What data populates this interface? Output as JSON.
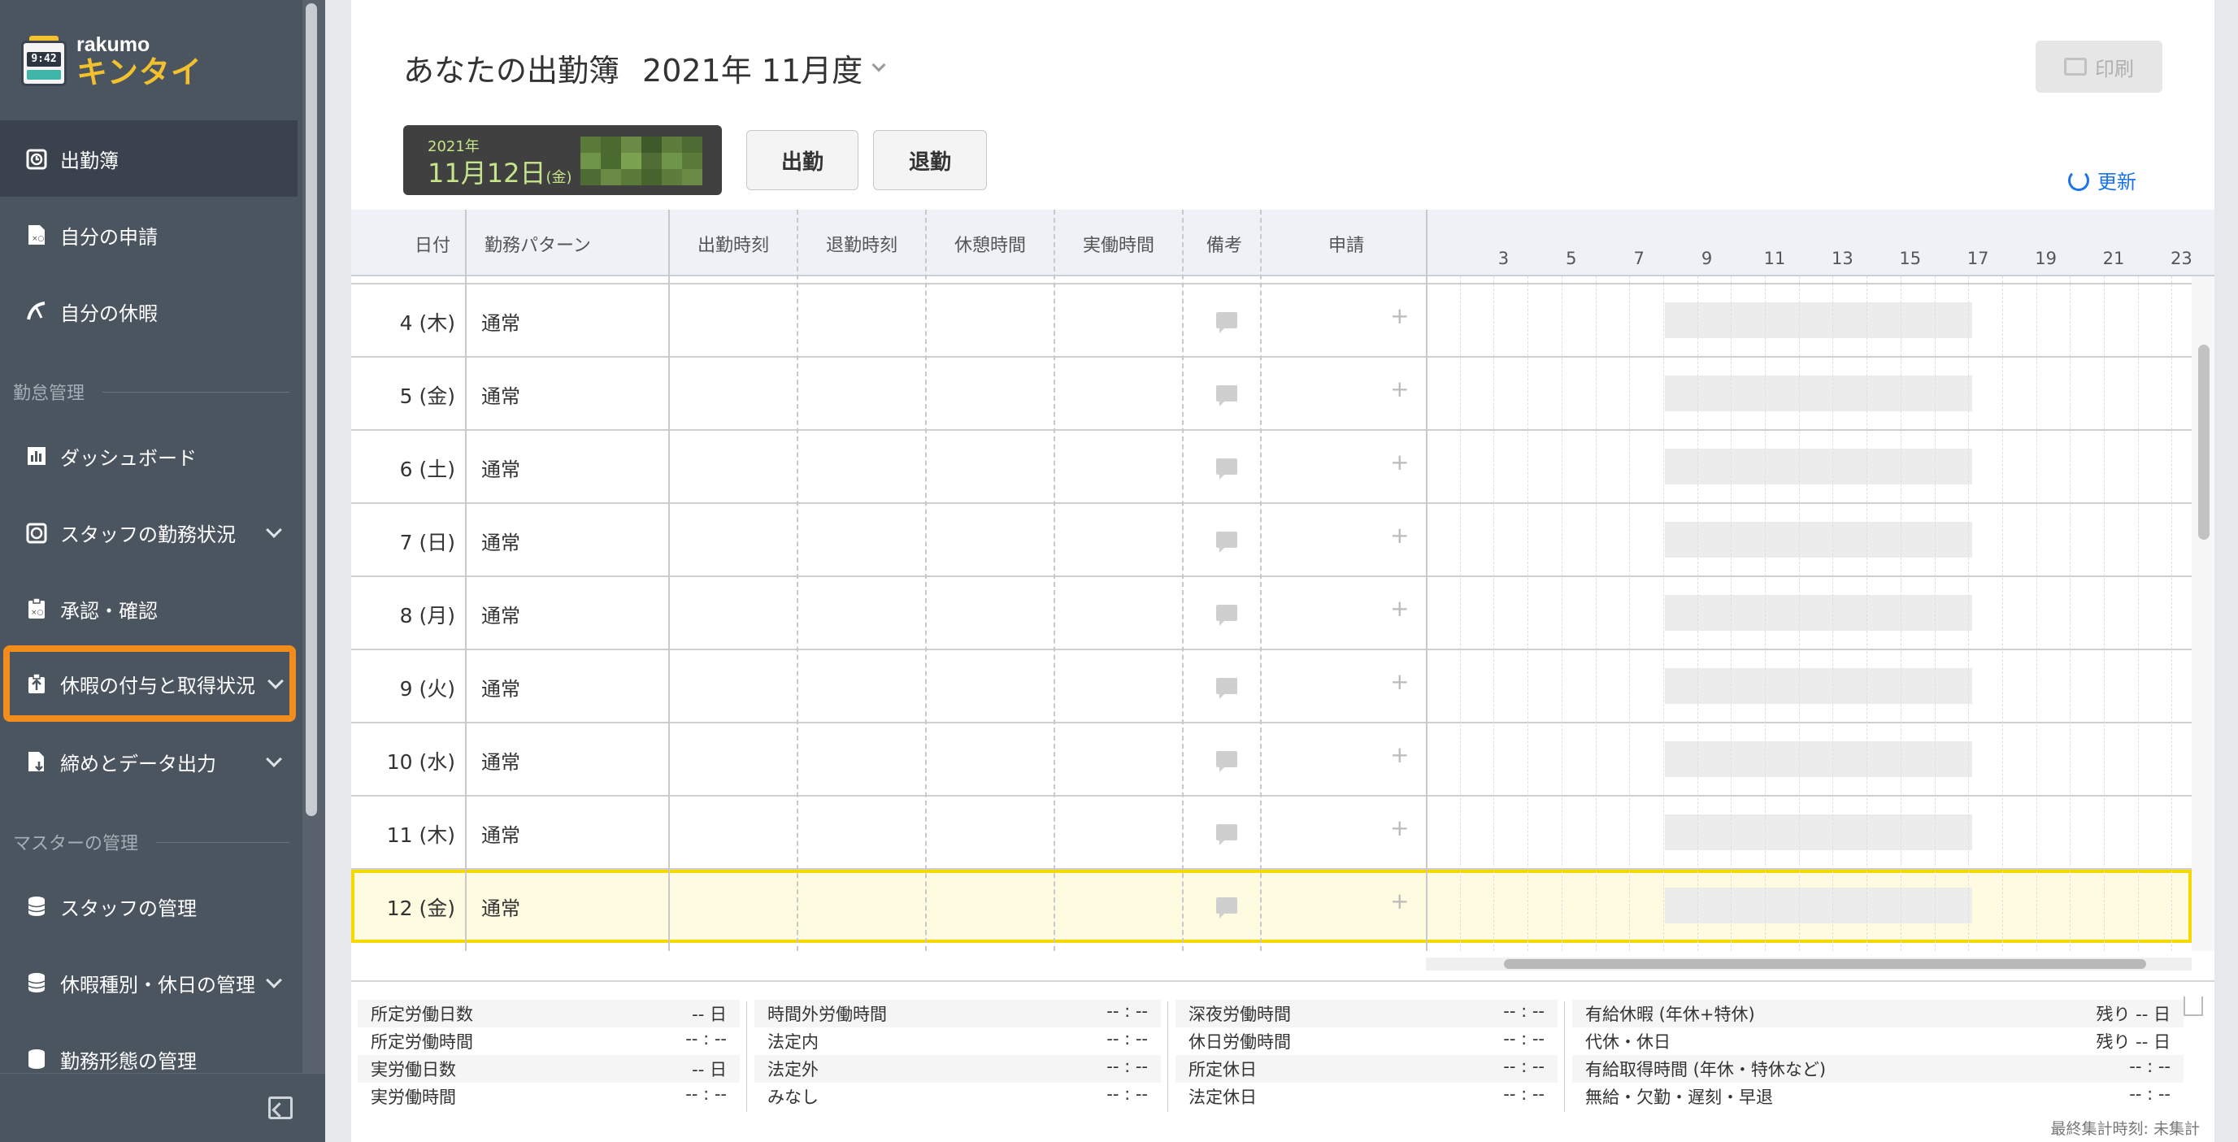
{
  "app": {
    "logo_top": "rakumo",
    "logo_bottom": "キンタイ",
    "clock_time": "9:42"
  },
  "sidebar": {
    "items": [
      {
        "label": "出勤簿",
        "icon": "clock-icon"
      },
      {
        "label": "自分の申請",
        "icon": "request-icon"
      },
      {
        "label": "自分の休暇",
        "icon": "vacation-icon"
      },
      {
        "label": "ダッシュボード",
        "icon": "chart-icon"
      },
      {
        "label": "スタッフの勤務状況",
        "icon": "clock-icon"
      },
      {
        "label": "承認・確認",
        "icon": "approve-icon"
      },
      {
        "label": "休暇の付与と取得状況",
        "icon": "gift-icon"
      },
      {
        "label": "締めとデータ出力",
        "icon": "export-icon"
      },
      {
        "label": "スタッフの管理",
        "icon": "database-icon"
      },
      {
        "label": "休暇種別・休日の管理",
        "icon": "database-icon"
      },
      {
        "label": "勤務形態の管理",
        "icon": "database-icon"
      }
    ],
    "sections": {
      "attendance": "勤怠管理",
      "master": "マスターの管理"
    }
  },
  "header": {
    "title": "あなたの出勤簿",
    "month": "2021年 11月度",
    "print_label": "印刷"
  },
  "today": {
    "year": "2021年",
    "date": "11月12日",
    "weekday": "(金)"
  },
  "actions": {
    "clock_in": "出勤",
    "clock_out": "退勤",
    "refresh": "更新"
  },
  "colors": {
    "sidebar_bg": "#4b5560",
    "accent_orange": "#f28c1c",
    "today_highlight": "#f5d800",
    "link_blue": "#1a73e8"
  },
  "table": {
    "columns": [
      "日付",
      "勤務パターン",
      "出勤時刻",
      "退勤時刻",
      "休憩時間",
      "実働時間",
      "備考",
      "申請"
    ],
    "hour_ticks": [
      "3",
      "5",
      "7",
      "9",
      "11",
      "13",
      "15",
      "17",
      "19",
      "21",
      "23"
    ],
    "rows": [
      {
        "day": "4 (木)",
        "pattern": "通常"
      },
      {
        "day": "5 (金)",
        "pattern": "通常"
      },
      {
        "day": "6 (土)",
        "pattern": "通常"
      },
      {
        "day": "7 (日)",
        "pattern": "通常"
      },
      {
        "day": "8 (月)",
        "pattern": "通常"
      },
      {
        "day": "9 (火)",
        "pattern": "通常"
      },
      {
        "day": "10 (水)",
        "pattern": "通常"
      },
      {
        "day": "11 (木)",
        "pattern": "通常"
      },
      {
        "day": "12 (金)",
        "pattern": "通常"
      }
    ]
  },
  "summary": {
    "col1": [
      {
        "label": "所定労働日数",
        "value": "-- 日"
      },
      {
        "label": "所定労働時間",
        "value": "-- : --"
      },
      {
        "label": "実労働日数",
        "value": "-- 日"
      },
      {
        "label": "実労働時間",
        "value": "-- : --"
      }
    ],
    "col2": [
      {
        "label": "時間外労働時間",
        "value": "-- : --"
      },
      {
        "label": "法定内",
        "value": "-- : --"
      },
      {
        "label": "法定外",
        "value": "-- : --"
      },
      {
        "label": "みなし",
        "value": "-- : --"
      }
    ],
    "col3": [
      {
        "label": "深夜労働時間",
        "value": "-- : --"
      },
      {
        "label": "休日労働時間",
        "value": "-- : --"
      },
      {
        "label": "所定休日",
        "value": "-- : --"
      },
      {
        "label": "法定休日",
        "value": "-- : --"
      }
    ],
    "col4": [
      {
        "label": "有給休暇 (年休+特休)",
        "value": "残り -- 日"
      },
      {
        "label": "代休・休日",
        "value": "残り -- 日"
      },
      {
        "label": "有給取得時間 (年休・特休など)",
        "value": "-- : --"
      },
      {
        "label": "無給・欠勤・遅刻・早退",
        "value": "-- : --"
      }
    ],
    "note": "最終集計時刻: 未集計"
  }
}
